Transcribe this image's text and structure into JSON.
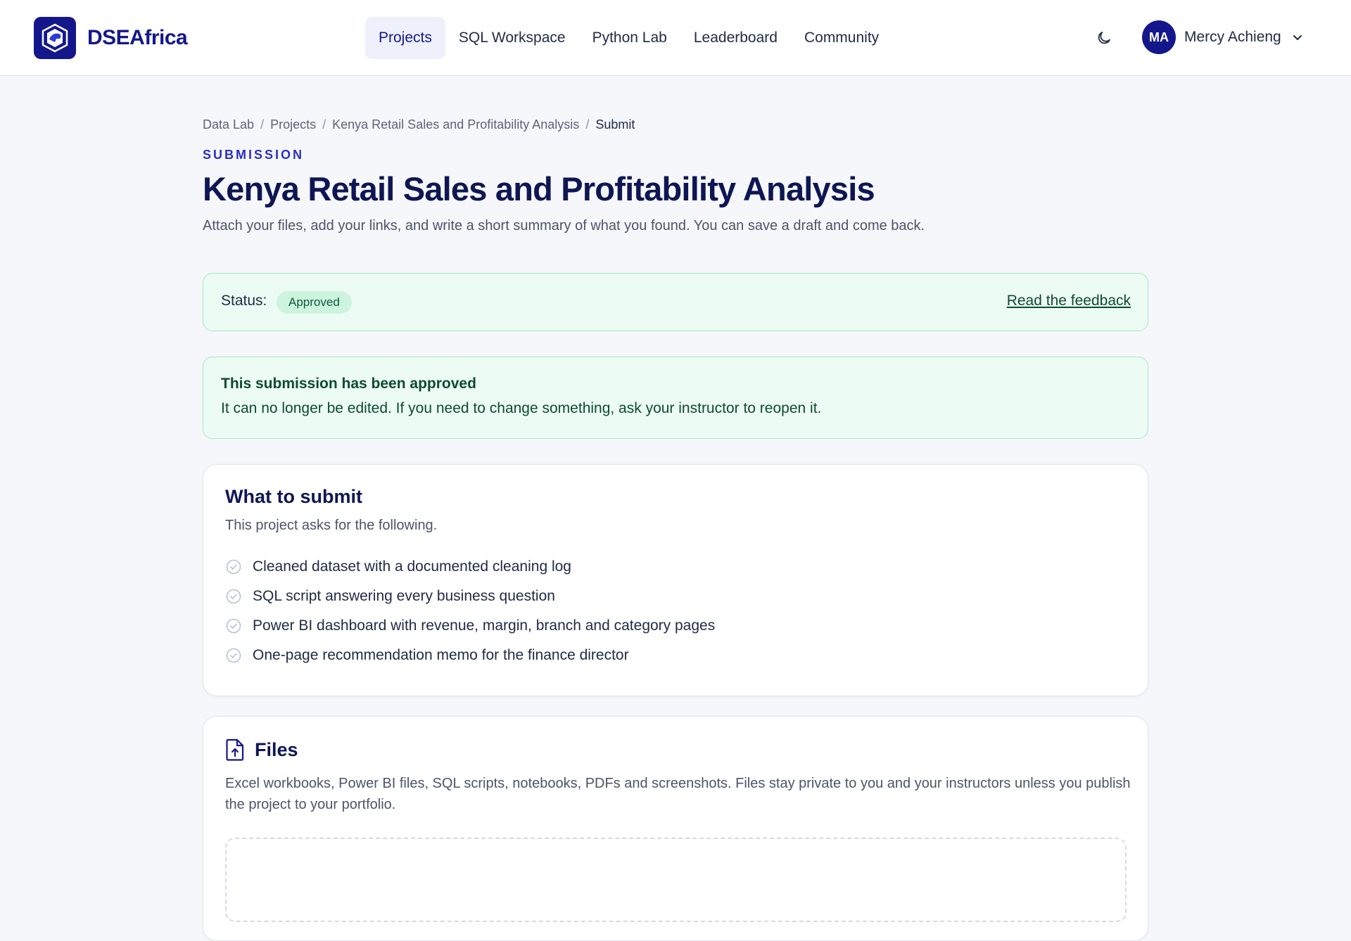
{
  "brand": {
    "name": "DSEAfrica",
    "logo_icon": "brand-logo-icon"
  },
  "nav": {
    "items": [
      {
        "label": "Projects",
        "active": true
      },
      {
        "label": "SQL Workspace",
        "active": false
      },
      {
        "label": "Python Lab",
        "active": false
      },
      {
        "label": "Leaderboard",
        "active": false
      },
      {
        "label": "Community",
        "active": false
      }
    ]
  },
  "header": {
    "theme_toggle_icon": "moon-icon"
  },
  "user": {
    "initials": "MA",
    "name": "Mercy Achieng"
  },
  "breadcrumb": {
    "items": [
      "Data Lab",
      "Projects",
      "Kenya Retail Sales and Profitability Analysis"
    ],
    "current": "Submit",
    "separator": "/"
  },
  "page": {
    "eyebrow": "SUBMISSION",
    "title": "Kenya Retail Sales and Profitability Analysis",
    "subtitle": "Attach your files, add your links, and write a short summary of what you found. You can save a draft and come back."
  },
  "status": {
    "label": "Status:",
    "badge": "Approved",
    "feedback_link": "Read the feedback"
  },
  "notice": {
    "title": "This submission has been approved",
    "body": "It can no longer be edited. If you need to change something, ask your instructor to reopen it."
  },
  "requirements": {
    "title": "What to submit",
    "description": "This project asks for the following.",
    "items": [
      "Cleaned dataset with a documented cleaning log",
      "SQL script answering every business question",
      "Power BI dashboard with revenue, margin, branch and category pages",
      "One-page recommendation memo for the finance director"
    ]
  },
  "files": {
    "title": "Files",
    "description": "Excel workbooks, Power BI files, SQL scripts, notebooks, PDFs and screenshots. Files stay private to you and your instructors unless you publish the project to your portfolio."
  },
  "colors": {
    "brand": "#14178c",
    "accent": "#2a2fc1",
    "success_bg": "#ecfbf3",
    "success_border": "#a7e8c4",
    "success_text": "#0d4a34"
  }
}
